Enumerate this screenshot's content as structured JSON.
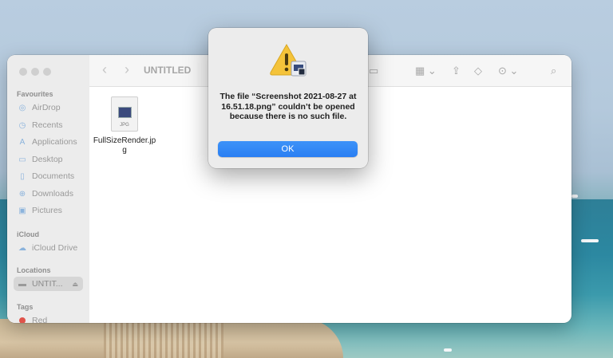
{
  "sidebar": {
    "favourites_label": "Favourites",
    "favourites": [
      {
        "label": "AirDrop",
        "icon": "airdrop-icon"
      },
      {
        "label": "Recents",
        "icon": "clock-icon"
      },
      {
        "label": "Applications",
        "icon": "applications-icon"
      },
      {
        "label": "Desktop",
        "icon": "desktop-icon"
      },
      {
        "label": "Documents",
        "icon": "document-icon"
      },
      {
        "label": "Downloads",
        "icon": "download-icon"
      },
      {
        "label": "Pictures",
        "icon": "pictures-icon"
      }
    ],
    "icloud_label": "iCloud",
    "icloud": [
      {
        "label": "iCloud Drive",
        "icon": "cloud-icon"
      }
    ],
    "locations_label": "Locations",
    "locations": [
      {
        "label": "UNTIT...",
        "icon": "drive-icon",
        "eject": "eject-icon"
      }
    ],
    "tags_label": "Tags",
    "tags": [
      {
        "label": "Red",
        "color": "#e0534a"
      }
    ]
  },
  "toolbar": {
    "title": "UNTITLED",
    "back": "‹",
    "forward": "›"
  },
  "files": [
    {
      "name": "FullSizeRender.jpg",
      "ext": "JPG"
    }
  ],
  "alert": {
    "message": "The file “Screenshot 2021-08-27 at 16.51.18.png” couldn’t be opened because there is no such file.",
    "ok_label": "OK"
  },
  "colors": {
    "accent": "#2a7ff3",
    "warning": "#f4c33a"
  }
}
